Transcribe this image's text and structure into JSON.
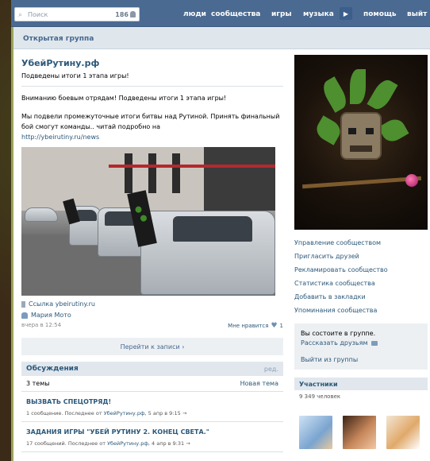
{
  "topbar": {
    "search_placeholder": "Поиск",
    "search_count": "186",
    "nav": [
      "люди",
      "сообщества",
      "игры",
      "музыка",
      "помощь",
      "выйт"
    ],
    "play_icon": "play-icon"
  },
  "group_bar": {
    "label": "Открытая группа"
  },
  "group": {
    "title": "УбейРутину.рф",
    "status": "Подведены итоги 1 этапа игры!"
  },
  "post": {
    "line1": "Вниманию боевым отрядам! Подведены итоги 1 этапа игры!",
    "line2": "Мы подвели промежуточные итоги битвы над Рутиной. Принять финальный бой смогут команды.. читай подробно на",
    "link": "http://ybeirutiny.ru/news",
    "attach_link": "Ссылка ybeirutiny.ru",
    "author": "Мария Мото",
    "date": "вчера в 12:54",
    "likes_label": "Мне нравится",
    "likes_count": "1"
  },
  "goto_post": "Перейти к записи ›",
  "discussions": {
    "title": "Обсуждения",
    "edit": "ред.",
    "count": "3 темы",
    "new_topic": "Новая тема",
    "topics": [
      {
        "title": "ВЫЗВАТЬ СПЕЦОТРЯД!",
        "info_prefix": "1 сообщение. Последнее от ",
        "info_author": "УбейРутину.рф",
        "info_suffix": ", 5 апр в 9:15 →"
      },
      {
        "title": "ЗАДАНИЯ ИГРЫ \"УБЕЙ РУТИНУ 2. КОНЕЦ СВЕТА.\"",
        "info_prefix": "17 сообщений. Последнее от ",
        "info_author": "УбейРутину.рф",
        "info_suffix": ", 4 апр в 9:31 →"
      }
    ]
  },
  "sidebar": {
    "links": [
      "Управление сообществом",
      "Пригласить друзей",
      "Рекламировать сообщество",
      "Статистика сообщества",
      "Добавить в закладки",
      "Упоминания сообщества"
    ],
    "membership": {
      "question": "Вы состоите в группе.",
      "share": "Рассказать друзьям",
      "leave": "Выйти из группы"
    },
    "members": {
      "title": "Участники",
      "count": "9 349 человек"
    }
  },
  "colors": {
    "topbar": "#4a6a92",
    "link": "#2b587a",
    "panel_header": "#dfe6ec"
  }
}
